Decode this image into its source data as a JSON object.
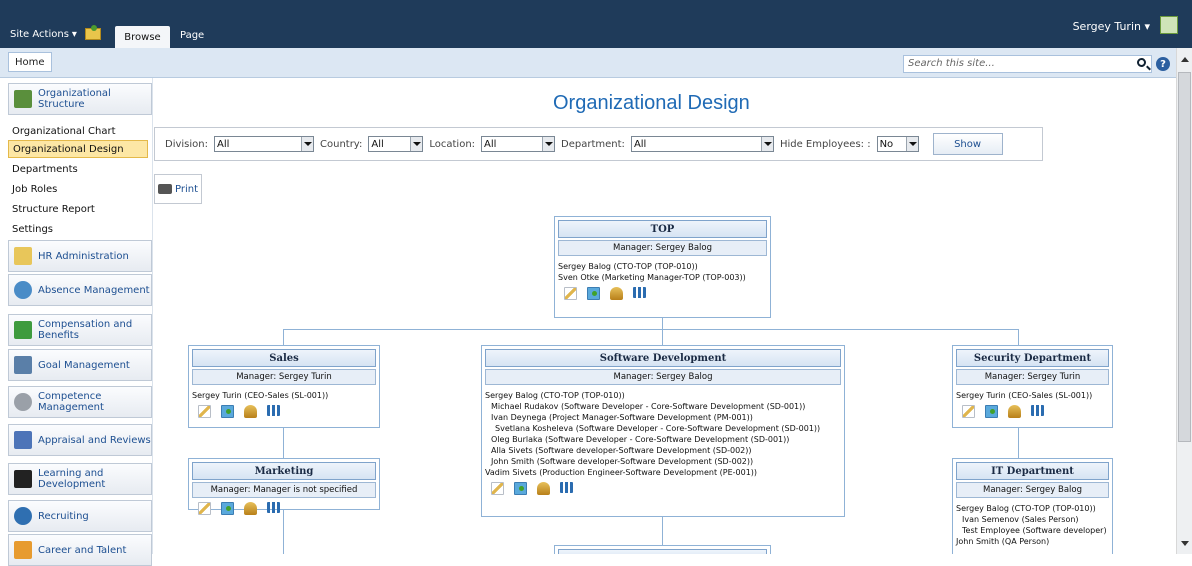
{
  "ribbon": {
    "site_actions": "Site Actions",
    "tabs": [
      "Browse",
      "Page"
    ],
    "user": "Sergey Turin"
  },
  "topnav": {
    "home": "Home",
    "search_placeholder": "Search this site..."
  },
  "sidebar": {
    "header": "Organizational Structure",
    "links": [
      {
        "label": "Organizational Chart",
        "active": false
      },
      {
        "label": "Organizational Design",
        "active": true
      },
      {
        "label": "Departments",
        "active": false
      },
      {
        "label": "Job Roles",
        "active": false
      },
      {
        "label": "Structure Report",
        "active": false
      },
      {
        "label": "Settings",
        "active": false
      }
    ],
    "categories": [
      {
        "label": "HR Administration",
        "icon": "folder-icon",
        "color": "#e8c65a"
      },
      {
        "label": "Absence Management",
        "icon": "clock-icon",
        "color": "#4a8cc7"
      },
      {
        "label": "Compensation and Benefits",
        "icon": "money-icon",
        "color": "#3e9b3e"
      },
      {
        "label": "Goal Management",
        "icon": "chart-icon",
        "color": "#5a7fa8"
      },
      {
        "label": "Competence Management",
        "icon": "gear-icon",
        "color": "#9aa0a8"
      },
      {
        "label": "Appraisal and Reviews",
        "icon": "bars-icon",
        "color": "#4d74b8"
      },
      {
        "label": "Learning and Development",
        "icon": "graduation-cap-icon",
        "color": "#222222"
      },
      {
        "label": "Recruiting",
        "icon": "person-icon",
        "color": "#2f6fb1"
      },
      {
        "label": "Career and Talent",
        "icon": "stairs-icon",
        "color": "#e79b2f"
      }
    ]
  },
  "main": {
    "title": "Organizational Design",
    "filters": {
      "division_label": "Division:",
      "division_value": "All",
      "country_label": "Country:",
      "country_value": "All",
      "location_label": "Location:",
      "location_value": "All",
      "department_label": "Department:",
      "department_value": "All",
      "hide_label": "Hide Employees: :",
      "hide_value": "No",
      "show_button": "Show"
    },
    "print_label": "Print"
  },
  "org": {
    "top": {
      "title": "TOP",
      "manager": "Manager: Sergey Balog",
      "employees": [
        "Sergey Balog (CTO-TOP (TOP-010))",
        "Sven Otke (Marketing Manager-TOP (TOP-003))"
      ]
    },
    "sales": {
      "title": "Sales",
      "manager": "Manager: Sergey Turin",
      "employees": [
        "Sergey Turin (CEO-Sales (SL-001))"
      ]
    },
    "marketing": {
      "title": "Marketing",
      "manager": "Manager: Manager is not specified"
    },
    "software": {
      "title": "Software Development",
      "manager": "Manager: Sergey Balog",
      "employees": [
        "Sergey Balog (CTO-TOP (TOP-010))",
        "Michael Rudakov (Software Developer - Core-Software Development (SD-001))",
        "Ivan Deynega (Project Manager-Software Development (PM-001))",
        "Svetlana Kosheleva (Software Developer - Core-Software Development (SD-001))",
        "Oleg Burlaka (Software Developer - Core-Software Development (SD-001))",
        "Alla Sivets (Software developer-Software Development (SD-002))",
        "John Smith (Software developer-Software Development (SD-002))",
        "Vadim Sivets (Production Engineer-Software Development (PE-001))"
      ]
    },
    "security": {
      "title": "Security Department",
      "manager": "Manager: Sergey Turin",
      "employees": [
        "Sergey Turin (CEO-Sales (SL-001))"
      ]
    },
    "it": {
      "title": "IT Department",
      "manager": "Manager: Sergey Balog",
      "employees": [
        "Sergey Balog (CTO-TOP (TOP-010))",
        "Ivan Semenov (Sales Person)",
        "Test Employee (Software developer)",
        "John Smith (QA Person)"
      ]
    }
  }
}
